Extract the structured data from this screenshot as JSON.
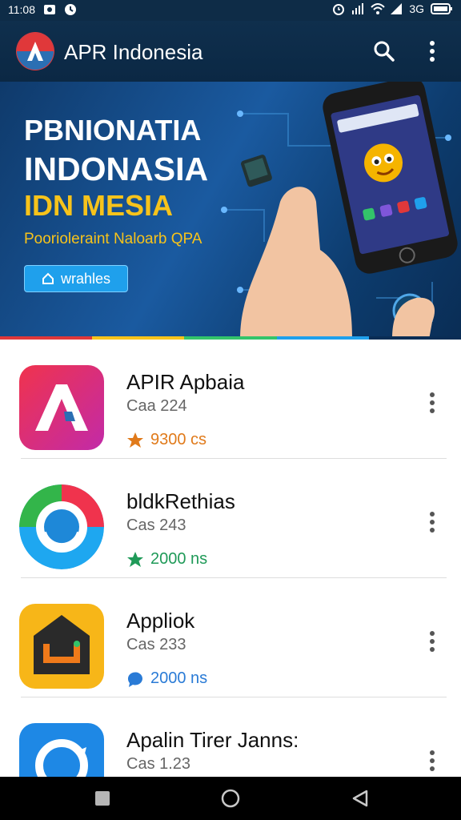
{
  "status_bar": {
    "time": "11:08",
    "right_text": "3G"
  },
  "app_bar": {
    "title": "APR Indonesia"
  },
  "banner": {
    "line1": "PBNIONATIA",
    "line2": "INDONASIA",
    "line3": "IDN MESIA",
    "subtitle": "Poorioleraint Naloarb QPA",
    "button_label": "wrahles"
  },
  "apps": [
    {
      "name": "APIR Apbaia",
      "sub": "Caa 224",
      "meta": "9300 cs",
      "meta_color": "#e07a1a"
    },
    {
      "name": "bldkRethias",
      "sub": "Cas 243",
      "meta": "2000 ns",
      "meta_color": "#1f9a58"
    },
    {
      "name": "Appliok",
      "sub": "Cas 233",
      "meta": "2000 ns",
      "meta_color": "#2a7bd6"
    },
    {
      "name": "Apalin Tirer Janns:",
      "sub": "Cas 1.23",
      "meta": "",
      "meta_color": "#666666"
    }
  ],
  "colors": {
    "appbar": "#0f2f4d",
    "accent_yellow": "#f7c31b",
    "banner_button": "#1fa0ec"
  }
}
